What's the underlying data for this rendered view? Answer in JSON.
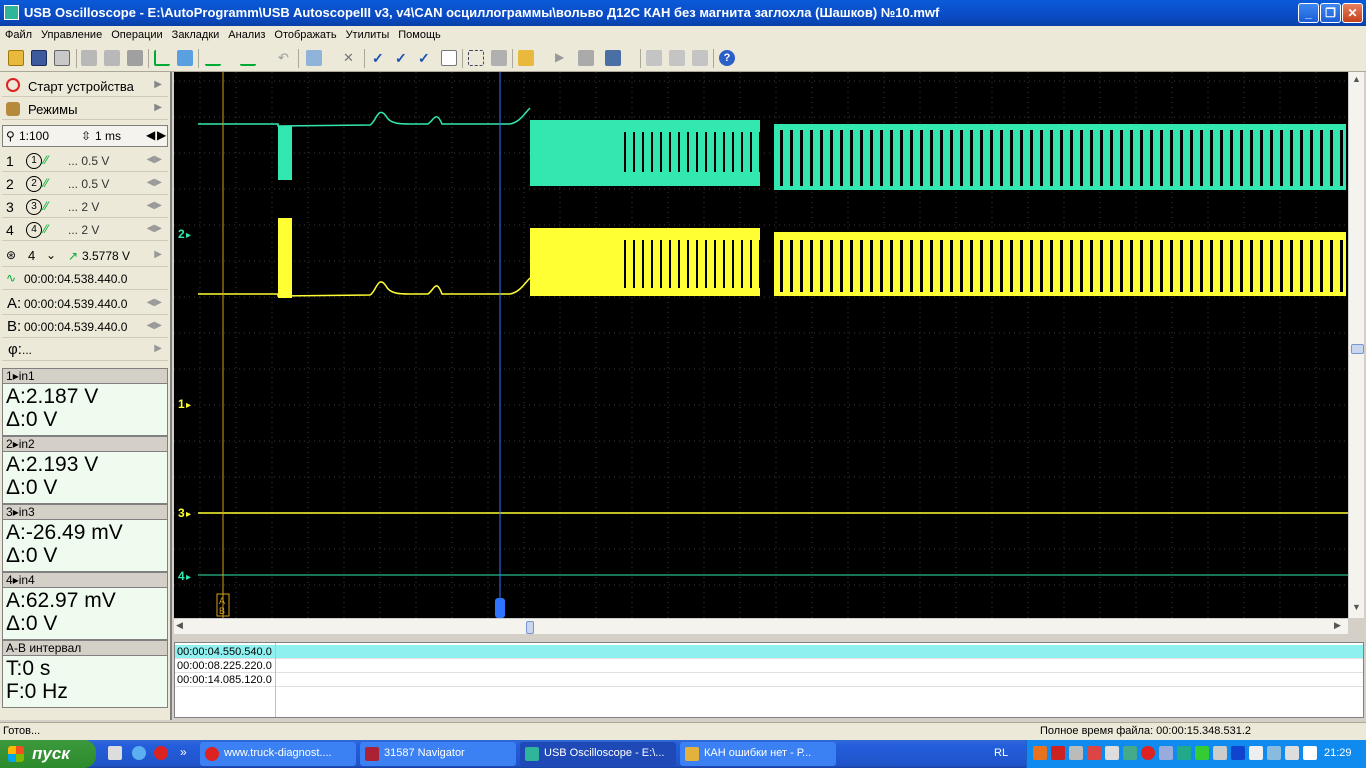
{
  "window": {
    "title": "USB Oscilloscope - E:\\AutoProgramm\\USB AutoscopeIII v3, v4\\CAN осциллограммы\\вольво Д12С КАН без магнита заглохла (Шашков) №10.mwf",
    "minimize": "_",
    "maximize": "❐",
    "close": "✕"
  },
  "menu": [
    "Файл",
    "Управление",
    "Операции",
    "Закладки",
    "Анализ",
    "Отображать",
    "Утилиты",
    "Помощь"
  ],
  "toolbar": {
    "icons": [
      "open-icon",
      "save-icon",
      "print-icon",
      "copy-icon",
      "paste-icon",
      "tool-icon",
      "cursor-icon",
      "channel-icon",
      "filter-icon",
      "math-icon",
      "undo-icon",
      "zoom-icon",
      "mark-icon",
      "check-icon",
      "check2-icon",
      "check3-icon",
      "notes-icon",
      "fit-icon",
      "scale-icon",
      "folder-icon",
      "play-icon",
      "stop-icon",
      "grid-icon",
      "chart-icon",
      "page-icon",
      "delete-icon",
      "help-icon"
    ]
  },
  "left": {
    "start": "Старт устройства",
    "modes": "Режимы",
    "zoom": "1:100",
    "timebase": "1 ms",
    "channels": [
      {
        "num": "1",
        "circle": "1",
        "val": "... 0.5 V"
      },
      {
        "num": "2",
        "circle": "2",
        "val": "... 0.5 V"
      },
      {
        "num": "3",
        "circle": "3",
        "val": "... 2 V"
      },
      {
        "num": "4",
        "circle": "4",
        "val": "... 2 V"
      }
    ],
    "trigger_ch": "4",
    "trigger_level": "3.5778 V",
    "trigger_time": "00:00:04.538.440.0",
    "cursor_a_label": "A:",
    "cursor_a": "00:00:04.539.440.0",
    "cursor_b_label": "B:",
    "cursor_b": "00:00:04.539.440.0",
    "phi_label": "φ:",
    "phi": "..."
  },
  "measure": [
    {
      "hdr": "in1",
      "num": "1",
      "a": "A:2.187 V",
      "d": "Δ:0 V"
    },
    {
      "hdr": "in2",
      "num": "2",
      "a": "A:2.193 V",
      "d": "Δ:0 V"
    },
    {
      "hdr": "in3",
      "num": "3",
      "a": "A:-26.49 mV",
      "d": "Δ:0 V"
    },
    {
      "hdr": "in4",
      "num": "4",
      "a": "A:62.97 mV",
      "d": "Δ:0 V"
    }
  ],
  "interval": {
    "hdr": "A-B интервал",
    "t": "T:0 s",
    "f": "F:0 Hz"
  },
  "scope": {
    "ch_labels": [
      {
        "label": "2",
        "color": "#33e8b0"
      },
      {
        "label": "1",
        "color": "#ffff33"
      },
      {
        "label": "3",
        "color": "#ffff33"
      },
      {
        "label": "4",
        "color": "#33e8b0"
      }
    ],
    "colors": {
      "ch1": "#ffff33",
      "ch2": "#33e8b0",
      "grid": "#3a3a3a",
      "cursor_a": "#d4a020",
      "cursor_b": "#2f74ff"
    },
    "cursor_tag_a": "A",
    "cursor_tag_b": "B"
  },
  "markers": [
    "00:00:04.550.540.0",
    "00:00:08.225.220.0",
    "00:00:14.085.120.0"
  ],
  "status": {
    "left": "Готов...",
    "right": "Полное время файла: 00:00:15.348.531.2"
  },
  "taskbar": {
    "start": "пуск",
    "tasks": [
      "www.truck-diagnost....",
      "31587 Navigator",
      "USB Oscilloscope - E:\\...",
      "КАН ошибки нет - Р..."
    ],
    "lang": "RL",
    "clock": "21:29"
  }
}
